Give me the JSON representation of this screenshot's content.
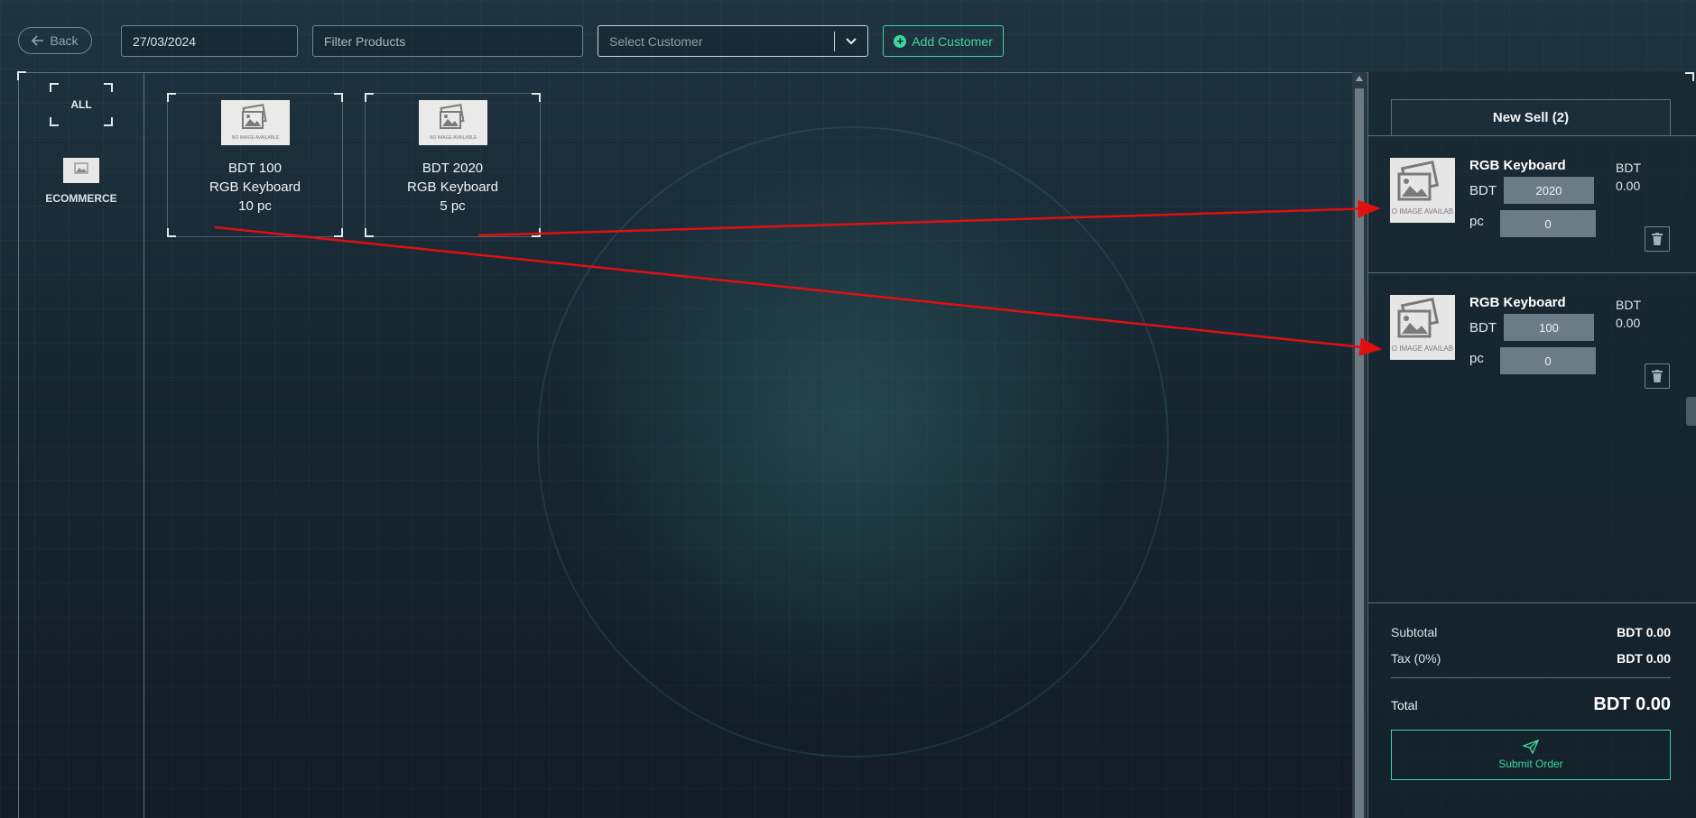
{
  "topbar": {
    "back_label": "Back",
    "date_value": "27/03/2024",
    "filter_placeholder": "Filter Products",
    "customer_placeholder": "Select Customer",
    "add_customer_label": "Add Customer"
  },
  "categories": [
    {
      "label": "ALL"
    },
    {
      "label": "ECOMMERCE",
      "image_text": "NO IMAGE AVAILABLE"
    }
  ],
  "products": [
    {
      "price": "BDT 100",
      "name": "RGB Keyboard",
      "stock": "10 pc",
      "image_text": "NO IMAGE AVAILABLE"
    },
    {
      "price": "BDT 2020",
      "name": "RGB Keyboard",
      "stock": "5 pc",
      "image_text": "NO IMAGE AVAILABLE"
    }
  ],
  "cart": {
    "tab_label": "New Sell (2)",
    "items": [
      {
        "name": "RGB Keyboard",
        "currency": "BDT",
        "price": "2020",
        "unit": "pc",
        "qty": "0",
        "total_currency": "BDT",
        "total": "0.00",
        "image_text": "O IMAGE AVAILAB"
      },
      {
        "name": "RGB Keyboard",
        "currency": "BDT",
        "price": "100",
        "unit": "pc",
        "qty": "0",
        "total_currency": "BDT",
        "total": "0.00",
        "image_text": "O IMAGE AVAILAB"
      }
    ],
    "summary": {
      "subtotal_label": "Subtotal",
      "subtotal_value": "BDT 0.00",
      "tax_label": "Tax (0%)",
      "tax_value": "BDT 0.00",
      "total_label": "Total",
      "total_value": "BDT 0.00"
    },
    "submit_label": "Submit Order"
  },
  "colors": {
    "accent": "#3fd6a0",
    "annotation_arrow": "#e01010",
    "background": "#172732"
  }
}
